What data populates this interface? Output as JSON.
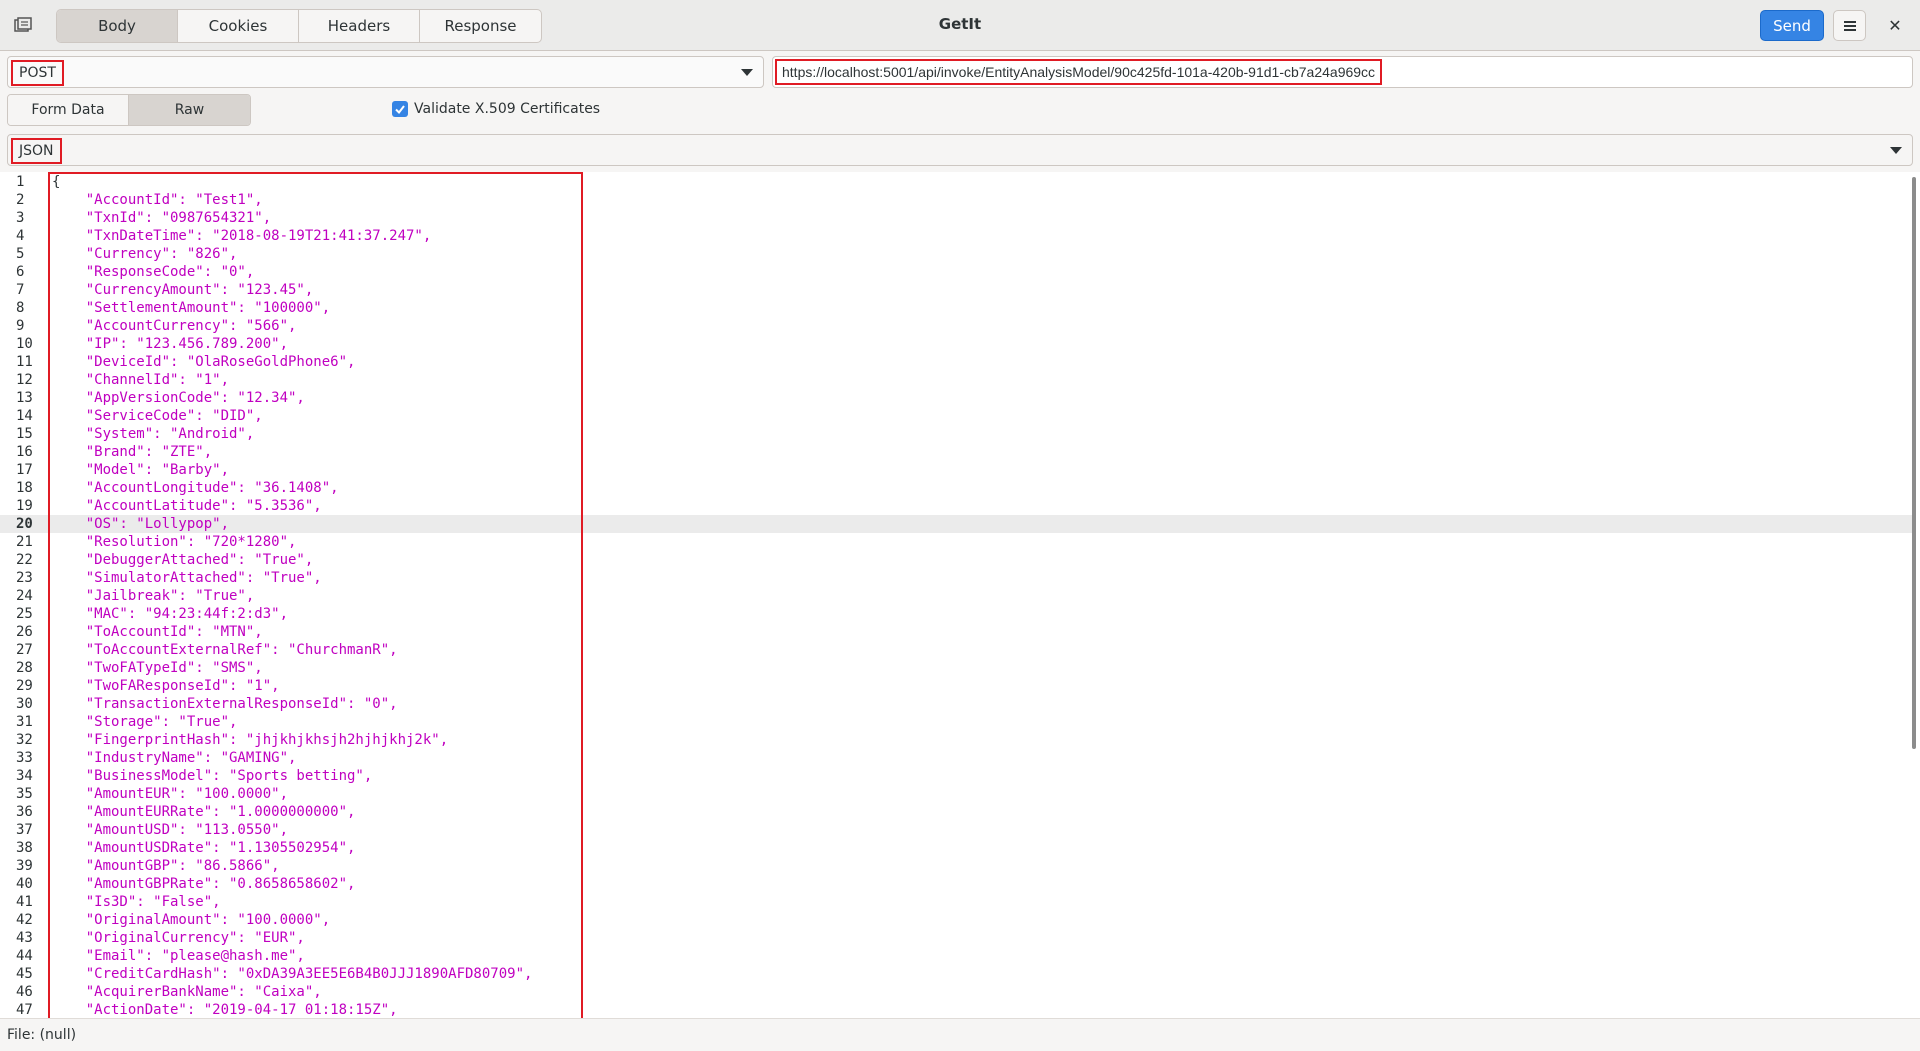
{
  "window": {
    "title": "GetIt"
  },
  "header": {
    "tabs": [
      {
        "label": "Body",
        "active": true
      },
      {
        "label": "Cookies",
        "active": false
      },
      {
        "label": "Headers",
        "active": false
      },
      {
        "label": "Response",
        "active": false
      }
    ],
    "send_label": "Send",
    "menu_icon": "hamburger-menu-icon",
    "close_glyph": "✕"
  },
  "request": {
    "method": "POST",
    "url": "https://localhost:5001/api/invoke/EntityAnalysisModel/90c425fd-101a-420b-91d1-cb7a24a969cc"
  },
  "body_tabs": [
    {
      "label": "Form Data",
      "active": false
    },
    {
      "label": "Raw",
      "active": true
    }
  ],
  "validate": {
    "label": "Validate X.509 Certificates",
    "checked": true
  },
  "format": {
    "value": "JSON"
  },
  "editor": {
    "current_line": 20,
    "lines": [
      "{",
      "    \"AccountId\": \"Test1\",",
      "    \"TxnId\": \"0987654321\",",
      "    \"TxnDateTime\": \"2018-08-19T21:41:37.247\",",
      "    \"Currency\": \"826\",",
      "    \"ResponseCode\": \"0\",",
      "    \"CurrencyAmount\": \"123.45\",",
      "    \"SettlementAmount\": \"100000\",",
      "    \"AccountCurrency\": \"566\",",
      "    \"IP\": \"123.456.789.200\",",
      "    \"DeviceId\": \"OlaRoseGoldPhone6\",",
      "    \"ChannelId\": \"1\",",
      "    \"AppVersionCode\": \"12.34\",",
      "    \"ServiceCode\": \"DID\",",
      "    \"System\": \"Android\",",
      "    \"Brand\": \"ZTE\",",
      "    \"Model\": \"Barby\",",
      "    \"AccountLongitude\": \"36.1408\",",
      "    \"AccountLatitude\": \"5.3536\",",
      "    \"OS\": \"Lollypop\",",
      "    \"Resolution\": \"720*1280\",",
      "    \"DebuggerAttached\": \"True\",",
      "    \"SimulatorAttached\": \"True\",",
      "    \"Jailbreak\": \"True\",",
      "    \"MAC\": \"94:23:44f:2:d3\",",
      "    \"ToAccountId\": \"MTN\",",
      "    \"ToAccountExternalRef\": \"ChurchmanR\",",
      "    \"TwoFATypeId\": \"SMS\",",
      "    \"TwoFAResponseId\": \"1\",",
      "    \"TransactionExternalResponseId\": \"0\",",
      "    \"Storage\": \"True\",",
      "    \"FingerprintHash\": \"jhjkhjkhsjh2hjhjkhj2k\",",
      "    \"IndustryName\": \"GAMING\",",
      "    \"BusinessModel\": \"Sports betting\",",
      "    \"AmountEUR\": \"100.0000\",",
      "    \"AmountEURRate\": \"1.0000000000\",",
      "    \"AmountUSD\": \"113.0550\",",
      "    \"AmountUSDRate\": \"1.1305502954\",",
      "    \"AmountGBP\": \"86.5866\",",
      "    \"AmountGBPRate\": \"0.8658658602\",",
      "    \"Is3D\": \"False\",",
      "    \"OriginalAmount\": \"100.0000\",",
      "    \"OriginalCurrency\": \"EUR\",",
      "    \"Email\": \"please@hash.me\",",
      "    \"CreditCardHash\": \"0xDA39A3EE5E6B4B0JJJ1890AFD80709\",",
      "    \"AcquirerBankName\": \"Caixa\",",
      "    \"ActionDate\": \"2019-04-17 01:18:15Z\","
    ]
  },
  "status": {
    "text": "File: (null)"
  }
}
